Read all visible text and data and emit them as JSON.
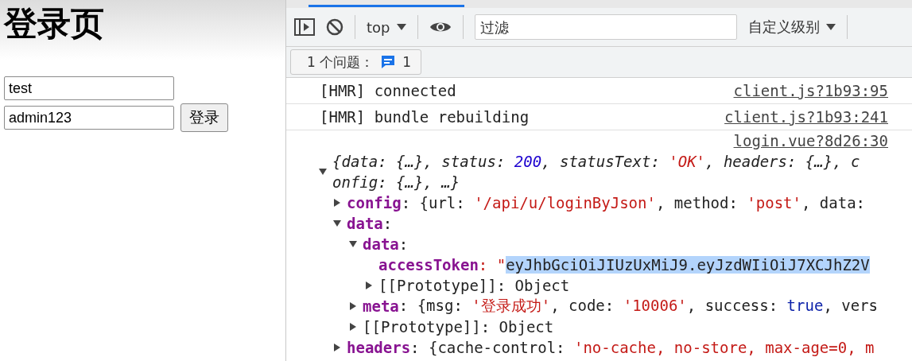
{
  "page": {
    "title": "登录页",
    "username": "test",
    "password": "admin123",
    "login_button": "登录"
  },
  "devtools": {
    "context": "top",
    "filter_placeholder": "过滤",
    "levels": "自定义级别",
    "issues": {
      "label": "1 个问题：",
      "count": "1"
    },
    "messages": [
      {
        "kind": "log",
        "text": "[HMR] connected",
        "source": "client.js?1b93:95"
      },
      {
        "kind": "log",
        "text": "[HMR] bundle rebuilding",
        "source": "client.js?1b93:241"
      },
      {
        "kind": "object",
        "source": "login.vue?8d26:30",
        "expanded": true,
        "summary": [
          {
            "text": "{data: {…}, status: ",
            "kind": "plain"
          },
          {
            "text": "200",
            "kind": "number"
          },
          {
            "text": ", statusText: ",
            "kind": "plain"
          },
          {
            "text": "'OK'",
            "kind": "string"
          },
          {
            "text": ", headers: {…}, config: {…}, …}",
            "kind": "plain"
          }
        ],
        "children": [
          {
            "key": "config",
            "kind": "branch",
            "expanded": false,
            "value": [
              {
                "text": ": {url: ",
                "kind": "plain"
              },
              {
                "text": "'/api/u/loginByJson'",
                "kind": "string"
              },
              {
                "text": ", method: ",
                "kind": "plain"
              },
              {
                "text": "'post'",
                "kind": "string"
              },
              {
                "text": ", data:",
                "kind": "plain"
              }
            ]
          },
          {
            "key": "data",
            "kind": "branch",
            "expanded": true,
            "value": [
              {
                "text": ":",
                "kind": "plain"
              }
            ],
            "children": [
              {
                "key": "data",
                "kind": "branch",
                "expanded": true,
                "value": [
                  {
                    "text": ":",
                    "kind": "plain"
                  }
                ],
                "children": [
                  {
                    "key": "accessToken",
                    "kind": "leaf",
                    "value": [
                      {
                        "text": ": \"",
                        "kind": "string"
                      },
                      {
                        "text": "eyJhbGciOiJIUzUxMiJ9.eyJzdWIiOiJ7XCJhZ2V",
                        "kind": "selection"
                      }
                    ]
                  },
                  {
                    "key": "[[Prototype]]",
                    "kind": "internal",
                    "expanded": false,
                    "value": [
                      {
                        "text": ": Object",
                        "kind": "plain"
                      }
                    ]
                  }
                ]
              },
              {
                "key": "meta",
                "kind": "branch",
                "expanded": false,
                "value": [
                  {
                    "text": ": {msg: ",
                    "kind": "plain"
                  },
                  {
                    "text": "'登录成功'",
                    "kind": "string"
                  },
                  {
                    "text": ", code: ",
                    "kind": "plain"
                  },
                  {
                    "text": "'10006'",
                    "kind": "string"
                  },
                  {
                    "text": ", success: ",
                    "kind": "plain"
                  },
                  {
                    "text": "true",
                    "kind": "keyword"
                  },
                  {
                    "text": ", vers",
                    "kind": "plain"
                  }
                ]
              },
              {
                "key": "[[Prototype]]",
                "kind": "internal",
                "expanded": false,
                "value": [
                  {
                    "text": ": Object",
                    "kind": "plain"
                  }
                ]
              }
            ]
          },
          {
            "key": "headers",
            "kind": "branch",
            "expanded": false,
            "value": [
              {
                "text": ": {cache-control: ",
                "kind": "plain"
              },
              {
                "text": "'no-cache, no-store, max-age=0, m",
                "kind": "string"
              }
            ]
          }
        ]
      }
    ]
  }
}
